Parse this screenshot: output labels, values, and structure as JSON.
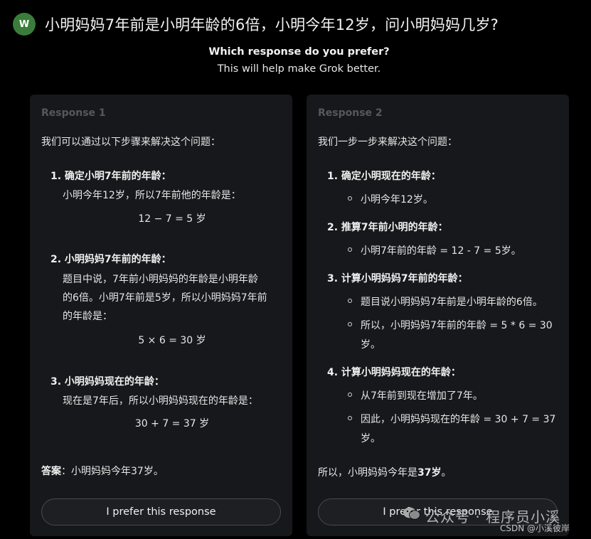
{
  "header": {
    "avatar_letter": "W",
    "question": "小明妈妈7年前是小明年龄的6倍，小明今年12岁，问小明妈妈几岁?"
  },
  "prompt": {
    "question": "Which response do you prefer?",
    "subtitle": "This will help make Grok better."
  },
  "response1": {
    "title": "Response 1",
    "intro": "我们可以通过以下步骤来解决这个问题：",
    "step1_heading": "1. 确定小明7年前的年龄：",
    "step1_line1": "小明今年12岁，所以7年前他的年龄是：",
    "step1_formula": "12 − 7 = 5 岁",
    "step2_heading": "2. 小明妈妈7年前的年龄：",
    "step2_line1": "题目中说，7年前小明妈妈的年龄是小明年龄",
    "step2_line2": "的6倍。小明7年前是5岁，所以小明妈妈7年前",
    "step2_line3": "的年龄是：",
    "step2_formula": "5 × 6 = 30 岁",
    "step3_heading": "3. 小明妈妈现在的年龄：",
    "step3_line1": "现在是7年后，所以小明妈妈现在的年龄是：",
    "step3_formula": "30 + 7 = 37 岁",
    "answer_label": "答案",
    "answer_text": "：小明妈妈今年37岁。",
    "button": "I prefer this response"
  },
  "response2": {
    "title": "Response 2",
    "intro": "我们一步一步来解决这个问题：",
    "step1_heading": "1. 确定小明现在的年龄：",
    "step1_bullet1": "小明今年12岁。",
    "step2_heading": "2. 推算7年前小明的年龄：",
    "step2_bullet1": "小明7年前的年龄 = 12 - 7 = 5岁。",
    "step3_heading": "3. 计算小明妈妈7年前的年龄：",
    "step3_bullet1": "题目说小明妈妈7年前是小明年龄的6倍。",
    "step3_bullet2_line1": "所以，小明妈妈7年前的年龄 = 5 * 6 = 30",
    "step3_bullet2_line2": "岁。",
    "step4_heading": "4. 计算小明妈妈现在的年龄：",
    "step4_bullet1": "从7年前到现在增加了7年。",
    "step4_bullet2_line1": "因此，小明妈妈现在的年龄 = 30 + 7 = 37",
    "step4_bullet2_line2": "岁。",
    "conclusion_prefix": "所以，小明妈妈今年是",
    "conclusion_bold": "37岁",
    "conclusion_suffix": "。",
    "button": "I prefer this response"
  },
  "watermark": {
    "wechat": "公众号 · 程序员小溪",
    "csdn": "CSDN @小溪彼岸"
  }
}
